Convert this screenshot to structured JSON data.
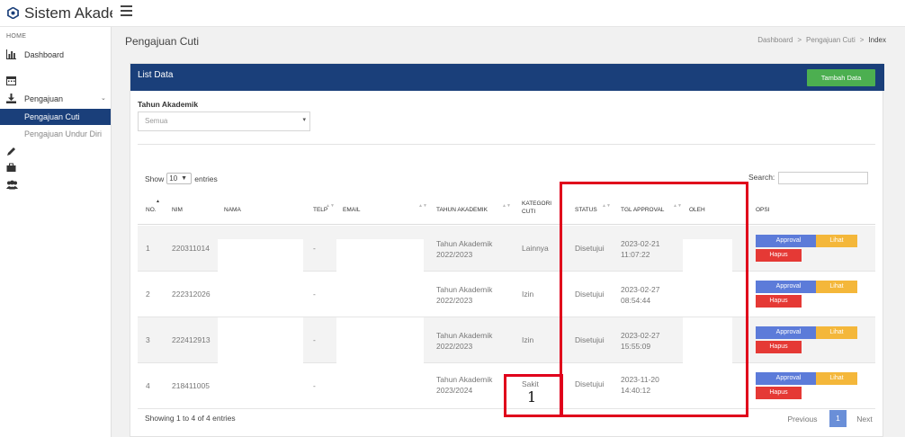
{
  "app": {
    "title": "Sistem Akademik"
  },
  "sidebar": {
    "home_label": "HOME",
    "dashboard": "Dashboard",
    "pengajuan": "Pengajuan",
    "pengajuan_cuti": "Pengajuan Cuti",
    "pengajuan_undur_diri": "Pengajuan Undur Diri"
  },
  "header": {
    "page_title": "Pengajuan Cuti",
    "breadcrumb": [
      "Dashboard",
      ">",
      "Pengajuan Cuti",
      ">",
      "Index"
    ]
  },
  "card": {
    "title": "List Data",
    "add_button": "Tambah Data",
    "filter_label": "Tahun Akademik",
    "filter_value": "Semua"
  },
  "table": {
    "show_label": "Show",
    "entries_value": "10",
    "entries_label": "entries",
    "search_label": "Search:",
    "headers": {
      "no": "NO.",
      "nim": "NIM",
      "nama": "NAMA",
      "telp": "TELP",
      "email": "EMAIL",
      "tahun": "TAHUN AKADEMIK",
      "kategori_1": "KATEGORI",
      "kategori_2": "CUTI",
      "status": "STATUS",
      "tgl": "TGL APPROVAL",
      "oleh": "OLEH",
      "opsi": "OPSI"
    },
    "rows": [
      {
        "no": "1",
        "nim": "220311014",
        "telp": "-",
        "tahun_1": "Tahun Akademik",
        "tahun_2": "2022/2023",
        "kategori": "Lainnya",
        "status": "Disetujui",
        "tgl_1": "2023-02-21",
        "tgl_2": "11:07:22"
      },
      {
        "no": "2",
        "nim": "222312026",
        "telp": "-",
        "tahun_1": "Tahun Akademik",
        "tahun_2": "2022/2023",
        "kategori": "Izin",
        "status": "Disetujui",
        "tgl_1": "2023-02-27",
        "tgl_2": "08:54:44"
      },
      {
        "no": "3",
        "nim": "222412913",
        "telp": "-",
        "tahun_1": "Tahun Akademik",
        "tahun_2": "2022/2023",
        "kategori": "Izin",
        "status": "Disetujui",
        "tgl_1": "2023-02-27",
        "tgl_2": "15:55:09"
      },
      {
        "no": "4",
        "nim": "218411005",
        "telp": "-",
        "tahun_1": "Tahun Akademik",
        "tahun_2": "2023/2024",
        "kategori": "Sakit",
        "status": "Disetujui",
        "tgl_1": "2023-11-20",
        "tgl_2": "14:40:12"
      }
    ],
    "approval_label": "Approval",
    "lihat_label": "Lihat",
    "hapus_label": "Hapus",
    "showing_text": "Showing 1 to 4 of 4 entries",
    "pager": {
      "prev": "Previous",
      "page": "1",
      "next": "Next"
    }
  },
  "annotation": {
    "label": "1",
    "color": "#e0001b"
  },
  "colors": {
    "primary": "#1a3f7a",
    "success": "#4caf50",
    "approval": "#5c7bd9",
    "lihat": "#f4b73a",
    "hapus": "#e53935"
  }
}
